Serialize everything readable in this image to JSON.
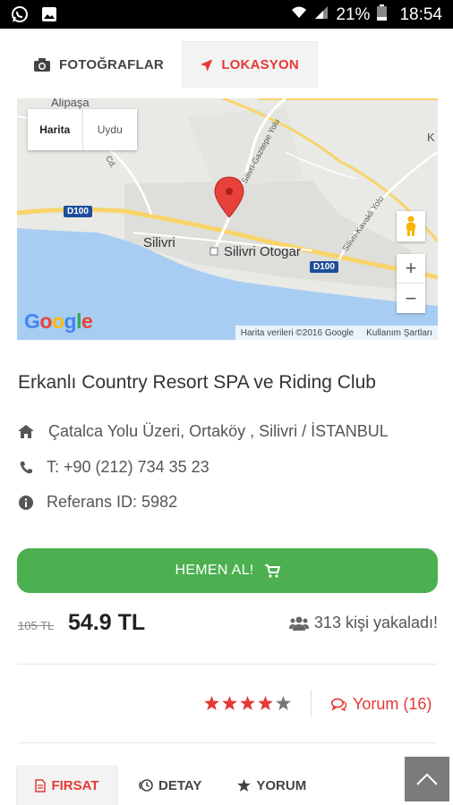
{
  "status_bar": {
    "battery_percent": "21%",
    "time": "18:54",
    "icons": [
      "whatsapp-icon",
      "gallery-icon",
      "wifi-icon",
      "signal-icon",
      "battery-icon"
    ]
  },
  "top_tabs": [
    {
      "label": "FOTOĞRAFLAR",
      "icon": "camera-icon",
      "active": false
    },
    {
      "label": "LOKASYON",
      "icon": "location-arrow-icon",
      "active": true
    }
  ],
  "map": {
    "type_buttons": [
      "Harita",
      "Uydu"
    ],
    "selected_type": "Harita",
    "labels": {
      "town": "Silivri",
      "bus_station": "Silivri Otogar",
      "top_label": "Alipaşa",
      "road_1": "D100",
      "road_2": "D100",
      "street_1": "Silivri-Gazitepe Yolu",
      "street_2": "Silivri-Kavakli Yolu",
      "street_3": "Cd."
    },
    "zoom_in": "+",
    "zoom_out": "−",
    "logo": "Google",
    "attribution": "Harita verileri ©2016 Google",
    "terms": "Kullanım Şartları"
  },
  "listing": {
    "title": "Erkanlı Country Resort SPA ve Riding Club",
    "address": "Çatalca Yolu Üzeri, Ortaköy , Silivri / İSTANBUL",
    "phone": "T: +90 (212) 734 35 23",
    "reference": "Referans ID: 5982"
  },
  "buy_button": {
    "label": "HEMEN AL!",
    "icon": "cart-icon"
  },
  "price": {
    "old": "105 TL",
    "new": "54.9 TL",
    "caught": "313 kişi yakaladı!"
  },
  "rating": {
    "stars": 4,
    "max": 5,
    "reviews_label": "Yorum (16)",
    "colors": {
      "star_on": "#e53935",
      "star_off": "#777777"
    }
  },
  "bottom_tabs": [
    {
      "label": "FIRSAT",
      "icon": "document-icon",
      "active": true
    },
    {
      "label": "DETAY",
      "icon": "clock-icon",
      "active": false
    },
    {
      "label": "YORUM",
      "icon": "star-icon",
      "active": false
    }
  ],
  "colors": {
    "accent_red": "#e53935",
    "buy_green": "#4cb050",
    "scroll_top_bg": "#7b7b7b"
  }
}
